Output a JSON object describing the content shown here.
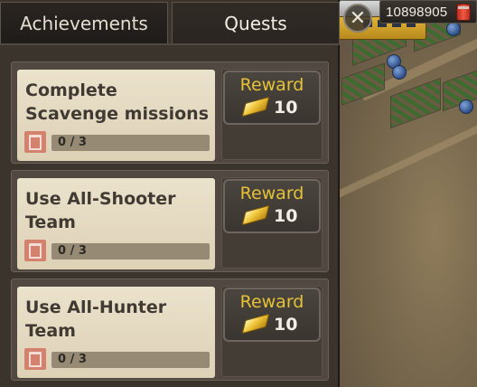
{
  "tabs": [
    {
      "label": "Achievements"
    },
    {
      "label": "Quests"
    }
  ],
  "active_tab": "Quests",
  "currency": {
    "value": "10898905",
    "icon": "resource-can-icon"
  },
  "close": {
    "icon": "close-icon"
  },
  "quests": [
    {
      "title": "Complete Scavenge missions",
      "progress_text": "0 / 3",
      "progress_fraction": 0,
      "reward_label": "Reward",
      "reward_amount": "10",
      "reward_icon": "gold-bar-icon"
    },
    {
      "title": "Use All-Shooter Team",
      "progress_text": "0 / 3",
      "progress_fraction": 0,
      "reward_label": "Reward",
      "reward_amount": "10",
      "reward_icon": "gold-bar-icon"
    },
    {
      "title": "Use All-Hunter Team",
      "progress_text": "0 / 3",
      "progress_fraction": 0,
      "reward_label": "Reward",
      "reward_amount": "10",
      "reward_icon": "gold-bar-icon"
    }
  ],
  "colors": {
    "reward_text": "#e6c238",
    "card_bg": "#e4dac2",
    "panel_bg": "#3a342d",
    "trash_button": "#d4816e"
  }
}
